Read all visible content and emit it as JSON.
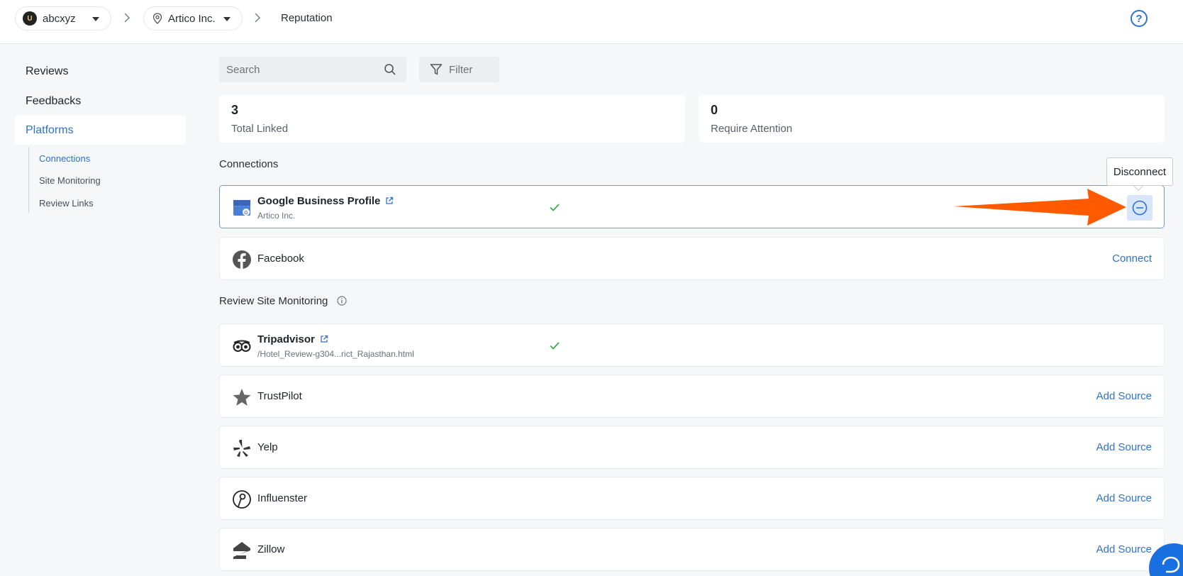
{
  "topbar": {
    "org_name": "abcxyz",
    "org_avatar_text": "U",
    "location_name": "Artico Inc.",
    "breadcrumb_current": "Reputation",
    "help_symbol": "?"
  },
  "sidebar": {
    "items": [
      {
        "label": "Reviews"
      },
      {
        "label": "Feedbacks"
      },
      {
        "label": "Platforms"
      }
    ],
    "subitems": [
      {
        "label": "Connections"
      },
      {
        "label": "Site Monitoring"
      },
      {
        "label": "Review Links"
      }
    ]
  },
  "toolbar": {
    "search_placeholder": "Search",
    "filter_label": "Filter"
  },
  "stats": [
    {
      "value": "3",
      "label": "Total Linked"
    },
    {
      "value": "0",
      "label": "Require Attention"
    }
  ],
  "connections": {
    "title": "Connections",
    "items": [
      {
        "name": "Google Business Profile",
        "subtitle": "Artico Inc.",
        "status": "connected"
      },
      {
        "name": "Facebook",
        "action": "Connect"
      }
    ]
  },
  "monitoring": {
    "title": "Review Site Monitoring",
    "items": [
      {
        "name": "Tripadvisor",
        "subtitle": "/Hotel_Review-g304...rict_Rajasthan.html",
        "status": "connected"
      },
      {
        "name": "TrustPilot",
        "action": "Add Source"
      },
      {
        "name": "Yelp",
        "action": "Add Source"
      },
      {
        "name": "Influenster",
        "action": "Add Source"
      },
      {
        "name": "Zillow",
        "action": "Add Source"
      }
    ]
  },
  "tooltip": {
    "label": "Disconnect"
  },
  "colors": {
    "accent": "#2d72d2",
    "success": "#3fae49",
    "annotation_arrow": "#ff5a00"
  }
}
